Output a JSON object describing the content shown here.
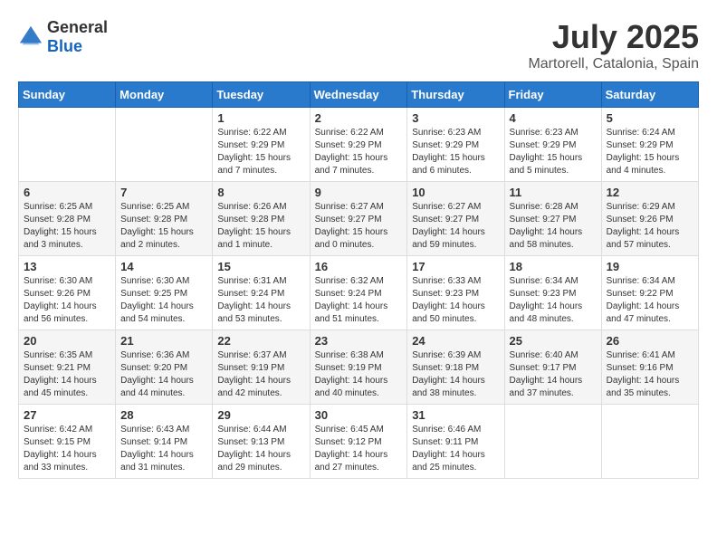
{
  "logo": {
    "text_general": "General",
    "text_blue": "Blue"
  },
  "header": {
    "month": "July 2025",
    "location": "Martorell, Catalonia, Spain"
  },
  "days_of_week": [
    "Sunday",
    "Monday",
    "Tuesday",
    "Wednesday",
    "Thursday",
    "Friday",
    "Saturday"
  ],
  "weeks": [
    [
      {
        "day": "",
        "info": ""
      },
      {
        "day": "",
        "info": ""
      },
      {
        "day": "1",
        "info": "Sunrise: 6:22 AM\nSunset: 9:29 PM\nDaylight: 15 hours and 7 minutes."
      },
      {
        "day": "2",
        "info": "Sunrise: 6:22 AM\nSunset: 9:29 PM\nDaylight: 15 hours and 7 minutes."
      },
      {
        "day": "3",
        "info": "Sunrise: 6:23 AM\nSunset: 9:29 PM\nDaylight: 15 hours and 6 minutes."
      },
      {
        "day": "4",
        "info": "Sunrise: 6:23 AM\nSunset: 9:29 PM\nDaylight: 15 hours and 5 minutes."
      },
      {
        "day": "5",
        "info": "Sunrise: 6:24 AM\nSunset: 9:29 PM\nDaylight: 15 hours and 4 minutes."
      }
    ],
    [
      {
        "day": "6",
        "info": "Sunrise: 6:25 AM\nSunset: 9:28 PM\nDaylight: 15 hours and 3 minutes."
      },
      {
        "day": "7",
        "info": "Sunrise: 6:25 AM\nSunset: 9:28 PM\nDaylight: 15 hours and 2 minutes."
      },
      {
        "day": "8",
        "info": "Sunrise: 6:26 AM\nSunset: 9:28 PM\nDaylight: 15 hours and 1 minute."
      },
      {
        "day": "9",
        "info": "Sunrise: 6:27 AM\nSunset: 9:27 PM\nDaylight: 15 hours and 0 minutes."
      },
      {
        "day": "10",
        "info": "Sunrise: 6:27 AM\nSunset: 9:27 PM\nDaylight: 14 hours and 59 minutes."
      },
      {
        "day": "11",
        "info": "Sunrise: 6:28 AM\nSunset: 9:27 PM\nDaylight: 14 hours and 58 minutes."
      },
      {
        "day": "12",
        "info": "Sunrise: 6:29 AM\nSunset: 9:26 PM\nDaylight: 14 hours and 57 minutes."
      }
    ],
    [
      {
        "day": "13",
        "info": "Sunrise: 6:30 AM\nSunset: 9:26 PM\nDaylight: 14 hours and 56 minutes."
      },
      {
        "day": "14",
        "info": "Sunrise: 6:30 AM\nSunset: 9:25 PM\nDaylight: 14 hours and 54 minutes."
      },
      {
        "day": "15",
        "info": "Sunrise: 6:31 AM\nSunset: 9:24 PM\nDaylight: 14 hours and 53 minutes."
      },
      {
        "day": "16",
        "info": "Sunrise: 6:32 AM\nSunset: 9:24 PM\nDaylight: 14 hours and 51 minutes."
      },
      {
        "day": "17",
        "info": "Sunrise: 6:33 AM\nSunset: 9:23 PM\nDaylight: 14 hours and 50 minutes."
      },
      {
        "day": "18",
        "info": "Sunrise: 6:34 AM\nSunset: 9:23 PM\nDaylight: 14 hours and 48 minutes."
      },
      {
        "day": "19",
        "info": "Sunrise: 6:34 AM\nSunset: 9:22 PM\nDaylight: 14 hours and 47 minutes."
      }
    ],
    [
      {
        "day": "20",
        "info": "Sunrise: 6:35 AM\nSunset: 9:21 PM\nDaylight: 14 hours and 45 minutes."
      },
      {
        "day": "21",
        "info": "Sunrise: 6:36 AM\nSunset: 9:20 PM\nDaylight: 14 hours and 44 minutes."
      },
      {
        "day": "22",
        "info": "Sunrise: 6:37 AM\nSunset: 9:19 PM\nDaylight: 14 hours and 42 minutes."
      },
      {
        "day": "23",
        "info": "Sunrise: 6:38 AM\nSunset: 9:19 PM\nDaylight: 14 hours and 40 minutes."
      },
      {
        "day": "24",
        "info": "Sunrise: 6:39 AM\nSunset: 9:18 PM\nDaylight: 14 hours and 38 minutes."
      },
      {
        "day": "25",
        "info": "Sunrise: 6:40 AM\nSunset: 9:17 PM\nDaylight: 14 hours and 37 minutes."
      },
      {
        "day": "26",
        "info": "Sunrise: 6:41 AM\nSunset: 9:16 PM\nDaylight: 14 hours and 35 minutes."
      }
    ],
    [
      {
        "day": "27",
        "info": "Sunrise: 6:42 AM\nSunset: 9:15 PM\nDaylight: 14 hours and 33 minutes."
      },
      {
        "day": "28",
        "info": "Sunrise: 6:43 AM\nSunset: 9:14 PM\nDaylight: 14 hours and 31 minutes."
      },
      {
        "day": "29",
        "info": "Sunrise: 6:44 AM\nSunset: 9:13 PM\nDaylight: 14 hours and 29 minutes."
      },
      {
        "day": "30",
        "info": "Sunrise: 6:45 AM\nSunset: 9:12 PM\nDaylight: 14 hours and 27 minutes."
      },
      {
        "day": "31",
        "info": "Sunrise: 6:46 AM\nSunset: 9:11 PM\nDaylight: 14 hours and 25 minutes."
      },
      {
        "day": "",
        "info": ""
      },
      {
        "day": "",
        "info": ""
      }
    ]
  ]
}
